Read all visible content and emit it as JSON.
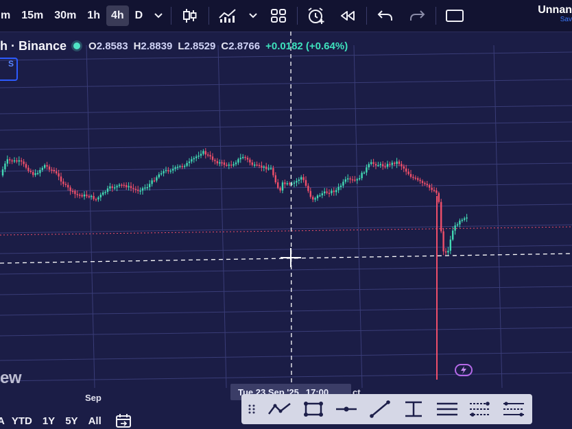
{
  "toolbar": {
    "timeframes": [
      {
        "label": "m",
        "active": false
      },
      {
        "label": "15m",
        "active": false
      },
      {
        "label": "30m",
        "active": false
      },
      {
        "label": "1h",
        "active": false
      },
      {
        "label": "4h",
        "active": true
      },
      {
        "label": "D",
        "active": false
      }
    ],
    "icons": [
      "chevron-down-icon",
      "candlestick-icon",
      "indicators-icon",
      "layout-grid-icon",
      "alert-clock-icon",
      "replay-icon",
      "undo-icon",
      "redo-icon",
      "fullscreen-icon"
    ],
    "layout_name": "Unnan",
    "layout_status": "Sav"
  },
  "legend": {
    "symbol": "h · Binance",
    "open_label": "O",
    "open": "2.8583",
    "high_label": "H",
    "high": "2.8839",
    "low_label": "L",
    "low": "2.8529",
    "close_label": "C",
    "close": "2.8766",
    "change": "+0.0182 (+0.64%)",
    "badge": "S"
  },
  "chart": {
    "watermark_fragment": "ew",
    "axis_label_sep": "Sep",
    "crosshair_date": "Tue 23 Sep '25",
    "crosshair_time": "17:00",
    "axis_label_oct_fragment": "ct",
    "colors": {
      "up": "#43d9b4",
      "down": "#ef4f6a",
      "grid": "#3a3d78",
      "background": "#1b1d46"
    }
  },
  "range_bar": {
    "items": [
      "A",
      "YTD",
      "1Y",
      "5Y",
      "All"
    ]
  },
  "drawing_toolbar": {
    "tools": [
      "drag-handle-icon",
      "path-icon",
      "rectangle-icon",
      "horizontal-ray-icon",
      "trend-line-icon",
      "cursor-text-icon",
      "parallel-lines-icon",
      "fib-retracement-icon",
      "channel-icon"
    ]
  }
}
